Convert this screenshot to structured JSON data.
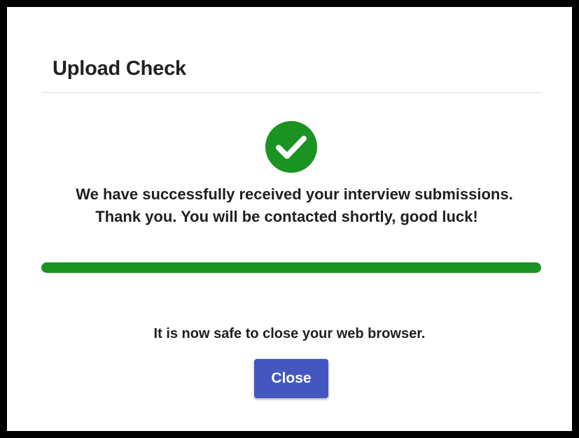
{
  "dialog": {
    "title": "Upload Check",
    "success_icon": "check-circle-icon",
    "message_line1": "We have successfully received your interview submissions.",
    "message_line2": "Thank you. You will be contacted shortly, good luck!",
    "progress": {
      "value_percent": 100
    },
    "safe_close_text": "It is now safe to close your web browser.",
    "close_button_label": "Close"
  },
  "colors": {
    "success_green": "#1a9322",
    "button_blue": "#4457c0",
    "page_border": "#000000"
  }
}
